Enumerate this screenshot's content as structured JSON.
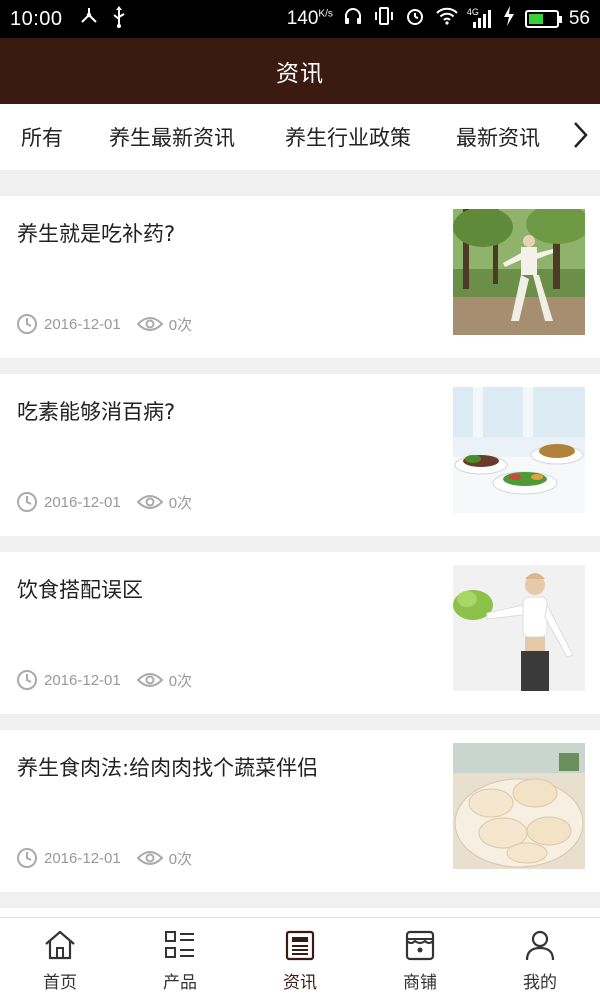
{
  "status_bar": {
    "time": "10:00",
    "net_speed": "140",
    "net_unit": "K/s",
    "network_type": "4G",
    "battery": "56",
    "battery_color": "#3ad03a"
  },
  "header": {
    "title": "资讯",
    "background": "#3b1a12"
  },
  "tabs": [
    {
      "label": "所有",
      "active": true
    },
    {
      "label": "养生最新资讯",
      "active": false
    },
    {
      "label": "养生行业政策",
      "active": false
    },
    {
      "label": "最新资讯",
      "active": false
    }
  ],
  "tabs_more_icon": "chevron-right-icon",
  "accent_color": "#c4161c",
  "articles": [
    {
      "title": "养生就是吃补药?",
      "date": "2016-12-01",
      "views": "0次",
      "image": "tai-chi-man-photo"
    },
    {
      "title": "吃素能够消百病?",
      "date": "2016-12-01",
      "views": "0次",
      "image": "vegetable-dishes-photo"
    },
    {
      "title": "饮食搭配误区",
      "date": "2016-12-01",
      "views": "0次",
      "image": "woman-holding-lettuce-photo"
    },
    {
      "title": "养生食肉法:给肉肉找个蔬菜伴侣",
      "date": "2016-12-01",
      "views": "0次",
      "image": "dumplings-photo"
    }
  ],
  "bottom_nav": [
    {
      "label": "首页",
      "icon": "home-icon",
      "active": false
    },
    {
      "label": "产品",
      "icon": "grid-list-icon",
      "active": false
    },
    {
      "label": "资讯",
      "icon": "news-icon",
      "active": true
    },
    {
      "label": "商铺",
      "icon": "shop-icon",
      "active": false
    },
    {
      "label": "我的",
      "icon": "user-icon",
      "active": false
    }
  ]
}
